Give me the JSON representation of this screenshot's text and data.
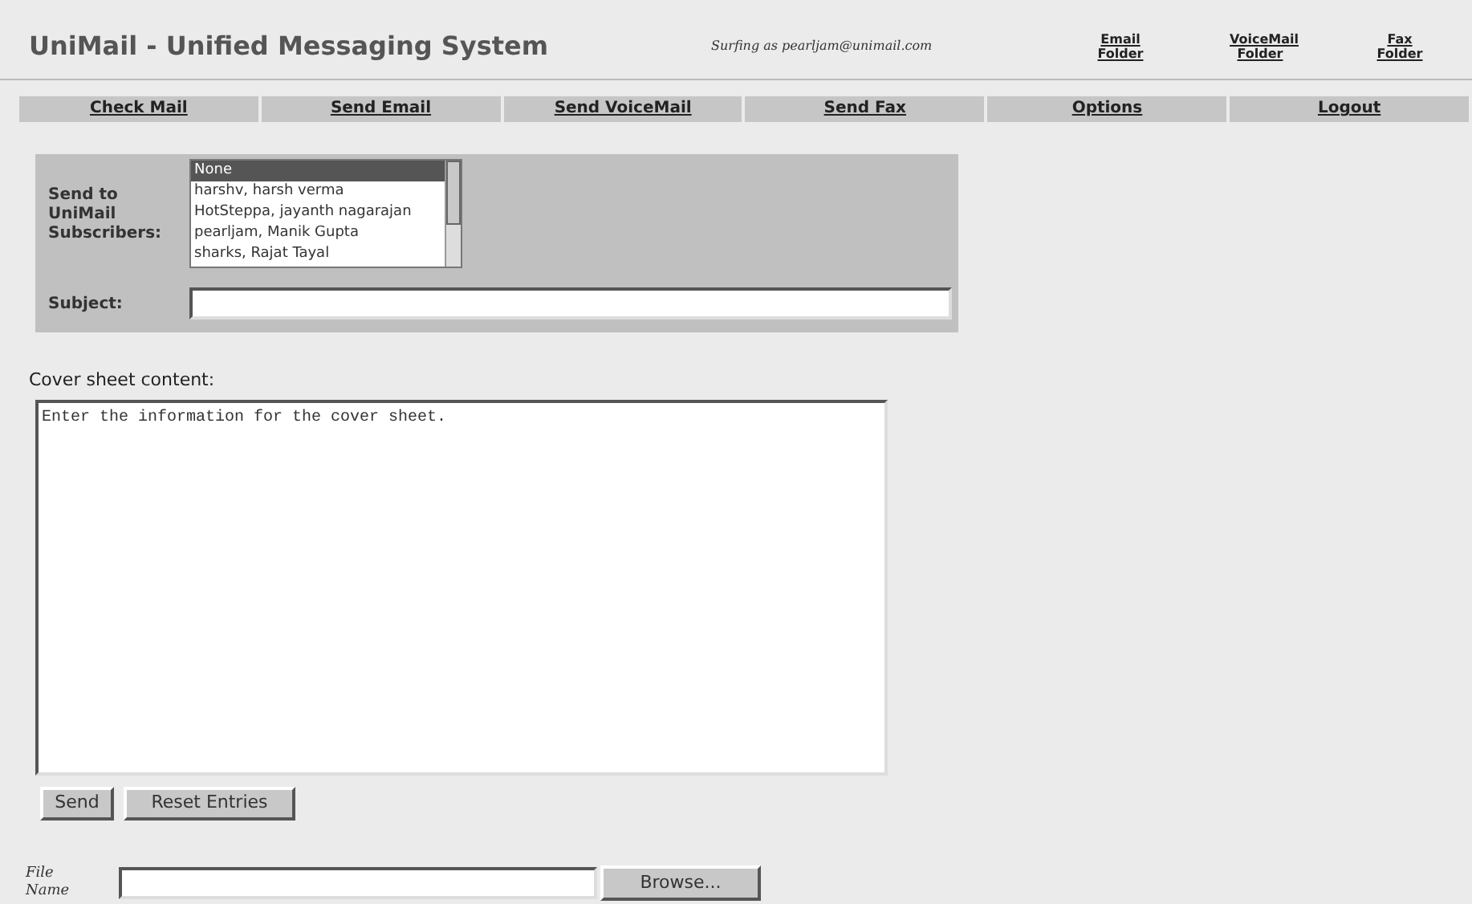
{
  "header": {
    "title": "UniMail - Unified Messaging System",
    "user": "Surfing as pearljam@unimail.com",
    "folder_links": [
      "Email Folder",
      "VoiceMail Folder",
      "Fax Folder"
    ]
  },
  "nav": [
    "Check Mail",
    "Send Email",
    "Send VoiceMail",
    "Send Fax",
    "Options",
    "Logout"
  ],
  "form": {
    "recipients_label": "Send to UniMail Subscribers:",
    "recipients": [
      {
        "label": "None",
        "selected": true
      },
      {
        "label": "harshv, harsh verma",
        "selected": false
      },
      {
        "label": "HotSteppa, jayanth nagarajan",
        "selected": false
      },
      {
        "label": "pearljam, Manik Gupta",
        "selected": false
      },
      {
        "label": "sharks, Rajat Tayal",
        "selected": false
      }
    ],
    "subject_label": "Subject:",
    "cover_label": "Cover sheet content:",
    "cover_value": "Enter the information for the cover sheet.",
    "buttons": [
      "Send",
      "Reset Entries"
    ],
    "file_label": "File Name",
    "browse": "Browse..."
  }
}
